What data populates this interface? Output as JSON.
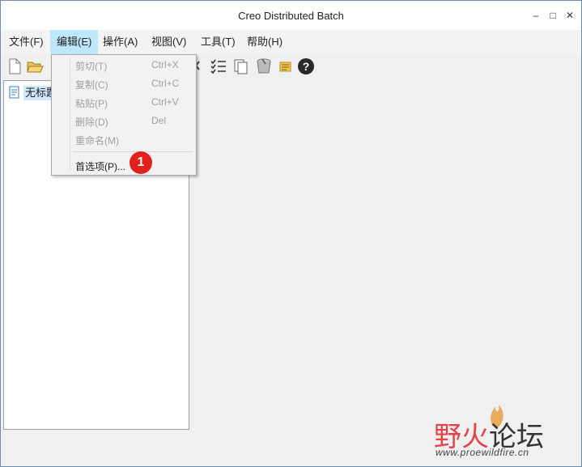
{
  "window": {
    "title": "Creo Distributed Batch",
    "minimize": "–",
    "maximize": "□",
    "close": "✕"
  },
  "menubar": {
    "items": [
      "文件(F)",
      "编辑(E)",
      "操作(A)",
      "视图(V)",
      "工具(T)",
      "帮助(H)"
    ],
    "active": "编辑(E)"
  },
  "toolbar": {
    "icons": [
      "new-file-icon",
      "open-folder-icon",
      "delete-x-icon",
      "checklist-icon",
      "copy-pages-icon",
      "clear-bucket-icon",
      "document-icon",
      "help-icon"
    ]
  },
  "tree": {
    "item_label": "无标题"
  },
  "edit_menu": {
    "items": [
      {
        "label": "剪切(T)",
        "shortcut": "Ctrl+X",
        "enabled": false
      },
      {
        "label": "复制(C)",
        "shortcut": "Ctrl+C",
        "enabled": false
      },
      {
        "label": "粘贴(P)",
        "shortcut": "Ctrl+V",
        "enabled": false
      },
      {
        "label": "删除(D)",
        "shortcut": "Del",
        "enabled": false
      },
      {
        "label": "重命名(M)",
        "shortcut": "",
        "enabled": false
      },
      {
        "label": "首选项(P)...",
        "shortcut": "",
        "enabled": true
      }
    ]
  },
  "annotation": {
    "badge_number": "1"
  },
  "watermark": {
    "title_part1": "野火",
    "title_part2": "论坛",
    "url": "www.proewildfire.cn"
  },
  "colors": {
    "menu_highlight": "#bee6fd",
    "badge_red": "#e3201b",
    "tree_selection": "#cfe8fc"
  }
}
